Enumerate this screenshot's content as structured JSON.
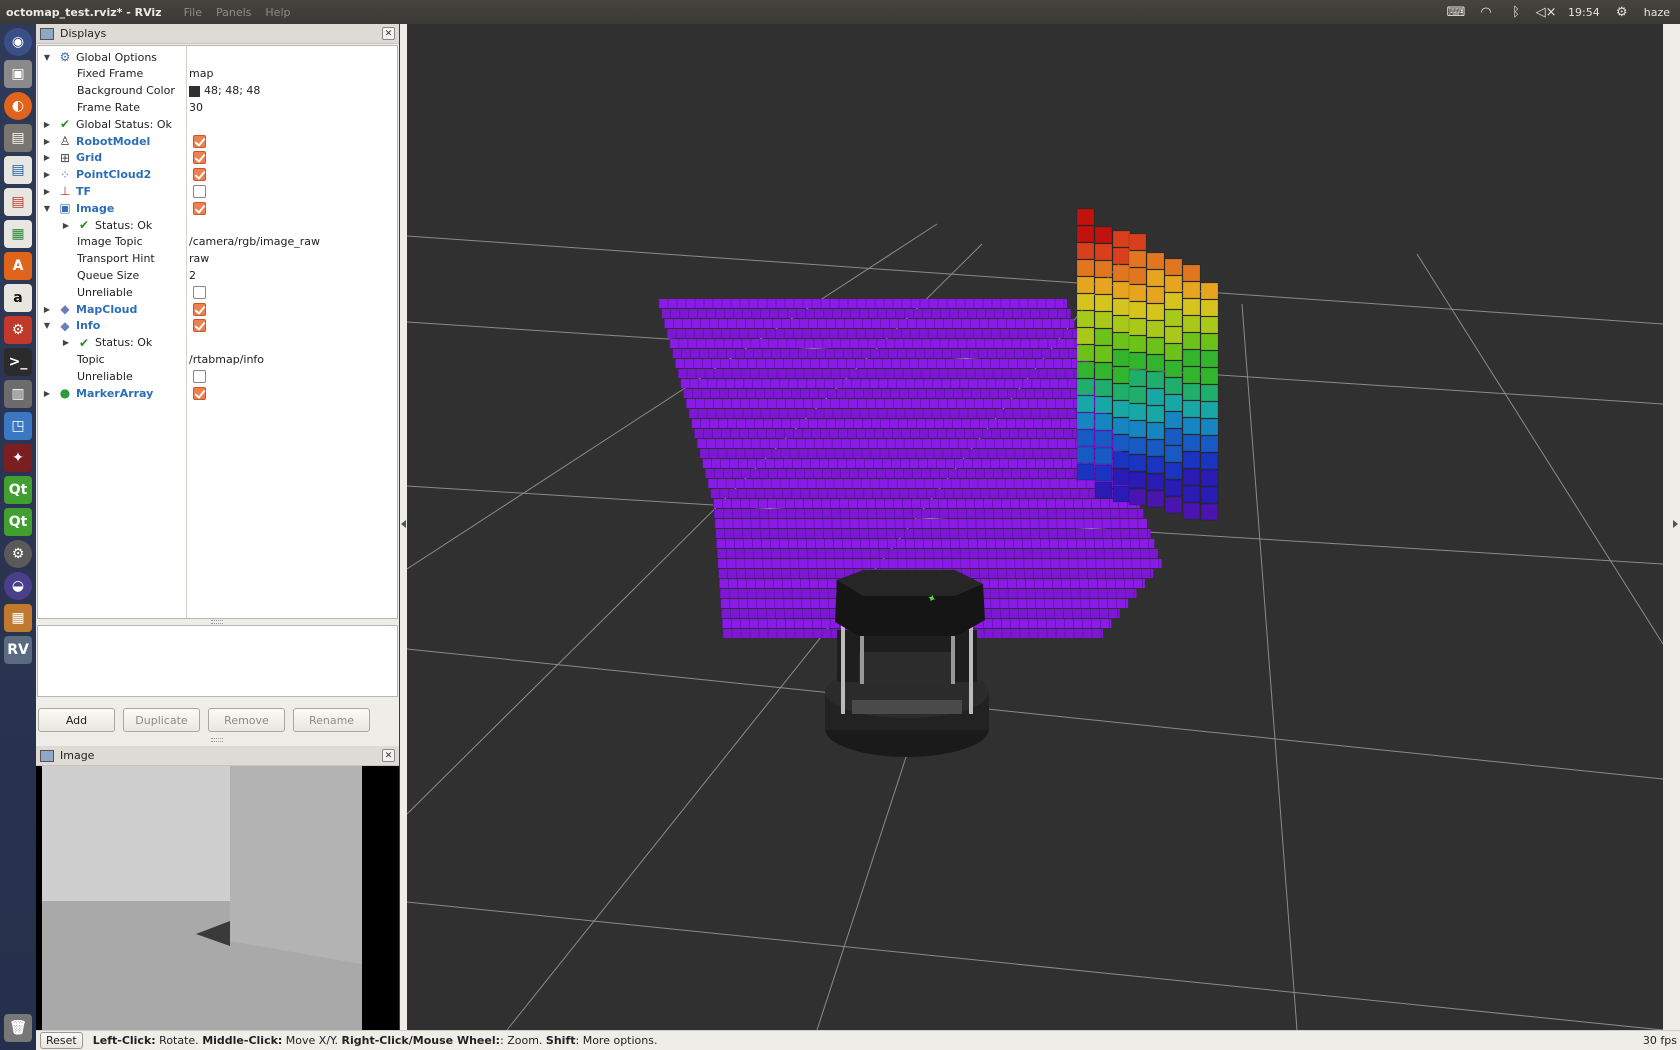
{
  "top_bar": {
    "window_title": "octomap_test.rviz* - RViz",
    "menus": [
      "File",
      "Panels",
      "Help"
    ],
    "time": "19:54",
    "user": "haze"
  },
  "launcher": {
    "items": [
      "dash-icon",
      "camera-app-icon",
      "firefox-icon",
      "files-icon",
      "writer-icon",
      "impress-icon",
      "calc-icon",
      "software-center-icon",
      "amazon-icon",
      "settings-icon",
      "terminal-icon",
      "app-icon",
      "remote-desktop-icon",
      "app2-icon",
      "qt-creator-icon",
      "qt-creator-icon-2",
      "system-tool-icon",
      "eclipse-icon",
      "workspaces-icon",
      "rviz-icon",
      "trash-icon"
    ]
  },
  "displays_panel": {
    "title": "Displays",
    "rows": [
      {
        "label": "Global Options",
        "indent": 0,
        "expander": "open",
        "icon": "gear-icon"
      },
      {
        "label": "Fixed Frame",
        "indent": 1,
        "value": "map"
      },
      {
        "label": "Background Color",
        "indent": 1,
        "value": "48; 48; 48",
        "swatch": "#303030"
      },
      {
        "label": "Frame Rate",
        "indent": 1,
        "value": "30"
      },
      {
        "label": "Global Status: Ok",
        "indent": 0,
        "expander": "closed",
        "icon": "check-icon"
      },
      {
        "label": "RobotModel",
        "indent": 0,
        "expander": "closed",
        "icon": "robot-model-icon",
        "display": true,
        "checked": true
      },
      {
        "label": "Grid",
        "indent": 0,
        "expander": "closed",
        "icon": "grid-icon",
        "display": true,
        "checked": true
      },
      {
        "label": "PointCloud2",
        "indent": 0,
        "expander": "closed",
        "icon": "pointcloud-icon",
        "display": true,
        "checked": true
      },
      {
        "label": "TF",
        "indent": 0,
        "expander": "closed",
        "icon": "tf-axes-icon",
        "display": true,
        "checked": false
      },
      {
        "label": "Image",
        "indent": 0,
        "expander": "open",
        "icon": "image-icon",
        "display": true,
        "checked": true
      },
      {
        "label": "Status: Ok",
        "indent": 1,
        "expander": "closed",
        "icon": "check-icon"
      },
      {
        "label": "Image Topic",
        "indent": 1,
        "value": "/camera/rgb/image_raw"
      },
      {
        "label": "Transport Hint",
        "indent": 1,
        "value": "raw"
      },
      {
        "label": "Queue Size",
        "indent": 1,
        "value": "2"
      },
      {
        "label": "Unreliable",
        "indent": 1,
        "checked": false
      },
      {
        "label": "MapCloud",
        "indent": 0,
        "expander": "closed",
        "icon": "diamond-icon",
        "display": true,
        "checked": true
      },
      {
        "label": "Info",
        "indent": 0,
        "expander": "open",
        "icon": "diamond-icon",
        "display": true,
        "checked": true
      },
      {
        "label": "Status: Ok",
        "indent": 1,
        "expander": "closed",
        "icon": "check-icon"
      },
      {
        "label": "Topic",
        "indent": 1,
        "value": "/rtabmap/info"
      },
      {
        "label": "Unreliable",
        "indent": 1,
        "checked": false
      },
      {
        "label": "MarkerArray",
        "indent": 0,
        "expander": "closed",
        "icon": "marker-array-icon",
        "display": true,
        "checked": true
      }
    ],
    "buttons": {
      "add": "Add",
      "duplicate": "Duplicate",
      "remove": "Remove",
      "rename": "Rename"
    }
  },
  "image_panel": {
    "title": "Image"
  },
  "status_bar": {
    "reset": "Reset",
    "hint": [
      {
        "bold": "Left-Click:",
        "text": " Rotate. "
      },
      {
        "bold": "Middle-Click:",
        "text": " Move X/Y. "
      },
      {
        "bold": "Right-Click/Mouse Wheel:",
        "text": ": Zoom. "
      },
      {
        "bold": "Shift",
        "text": ": More options."
      }
    ],
    "fps": "30 fps"
  },
  "colors": {
    "background": "#303030",
    "occupancy_floor": "#8a1be6",
    "checkbox_accent": "#f07f4e",
    "display_link": "#2c6fb6"
  }
}
